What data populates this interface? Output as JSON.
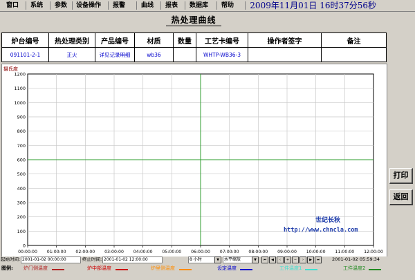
{
  "menu": [
    "窗口",
    "系统",
    "参数",
    "设备操作",
    "报警",
    "曲线",
    "报表",
    "数据库",
    "帮助"
  ],
  "clock": "2009年11月01日 16时37分56秒",
  "title": "热处理曲线",
  "table": {
    "headers": [
      "炉台编号",
      "热处理类别",
      "产品编号",
      "材质",
      "数量",
      "工艺卡编号",
      "操作者签字",
      "备注"
    ],
    "values": [
      "091101-2-1",
      "正火",
      "详见记录明细",
      "wb36",
      "",
      "WHTP-WB36-3",
      "",
      ""
    ]
  },
  "chart_data": {
    "type": "line",
    "ylabel": "摄氏度",
    "ylim": [
      0,
      1200
    ],
    "yticks": [
      0,
      100,
      200,
      300,
      400,
      500,
      600,
      700,
      800,
      900,
      1000,
      1100,
      1200
    ],
    "xticks": [
      "00:00:00",
      "01:00:00",
      "02:00:00",
      "03:00:00",
      "04:00:00",
      "05:00:00",
      "06:00:00",
      "07:00:00",
      "08:00:00",
      "09:00:00",
      "10:00:00",
      "11:00:00",
      "12:00:00"
    ],
    "reference_lines": {
      "horizontal_value": 600,
      "vertical_tick": "06:00:00",
      "color": "#2e9e2e"
    },
    "grid": true,
    "series": []
  },
  "watermark": {
    "line1": "世纪长秋",
    "line2": "http://www.chncla.com"
  },
  "buttons": {
    "print": "打印",
    "back": "返回"
  },
  "status": {
    "start_label": "起始时间:",
    "start_value": "2001-01-02 00:00:00",
    "end_label": "终止时间:",
    "end_value": "2001-01-02 12:00:00",
    "span_value": "8 小时",
    "zoom_value": "水平缩放",
    "cursor_time": "2001-01-02 05:59:34"
  },
  "legend": {
    "label": "图例:",
    "items": [
      {
        "name": "炉门侧温度",
        "color": "#b22222"
      },
      {
        "name": "炉中部温度",
        "color": "#cc0000"
      },
      {
        "name": "炉里侧温度",
        "color": "#ff8c00"
      },
      {
        "name": "设定温度",
        "color": "#0000cd"
      },
      {
        "name": "工件温度1",
        "color": "#40e0d0"
      },
      {
        "name": "工件温度2",
        "color": "#228b22"
      }
    ]
  }
}
